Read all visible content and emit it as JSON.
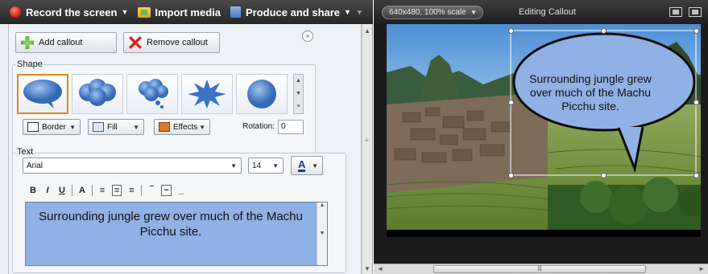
{
  "toolbar": {
    "record_label": "Record the screen",
    "import_label": "Import media",
    "produce_label": "Produce and share"
  },
  "callout_panel": {
    "add_label": "Add callout",
    "remove_label": "Remove callout",
    "shape_label": "Shape",
    "border_label": "Border",
    "fill_label": "Fill",
    "effects_label": "Effects",
    "rotation_label": "Rotation:",
    "rotation_value": "0",
    "text_label": "Text",
    "font_value": "Arial",
    "size_value": "14",
    "format": {
      "bold": "B",
      "italic": "I",
      "underline": "U",
      "case": "A"
    },
    "callout_text": "Surrounding jungle grew over much of the Machu Picchu site."
  },
  "preview": {
    "scale_label": "640x480, 100% scale",
    "title": "Editing Callout",
    "callout_text": "Surrounding jungle grew over much of the Machu Picchu site."
  },
  "colors": {
    "selected_border": "#e2861f",
    "callout_fill": "#8fb1e3",
    "toolbar_bg": "#2f2f2f"
  }
}
